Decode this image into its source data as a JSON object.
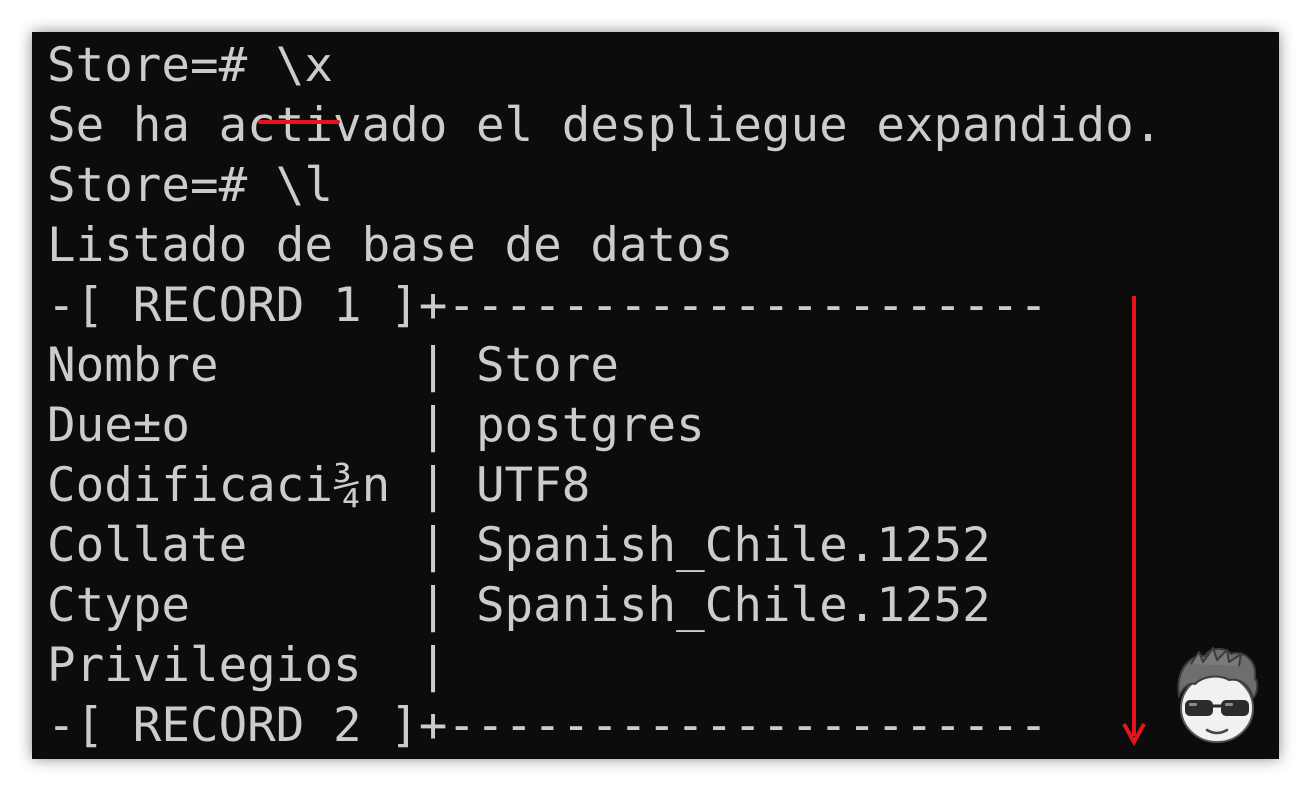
{
  "terminal": {
    "lines": [
      "Store=# \\x",
      "Se ha activado el despliegue expandido.",
      "Store=# \\l",
      "Listado de base de datos",
      "-[ RECORD 1 ]+---------------------",
      "Nombre       | Store",
      "Due±o        | postgres",
      "Codificaci¾n | UTF8",
      "Collate      | Spanish_Chile.1252",
      "Ctype        | Spanish_Chile.1252",
      "Privilegios  |",
      "-[ RECORD 2 ]+---------------------"
    ]
  },
  "annotations": {
    "underline_color": "#e8141b",
    "arrow_color": "#e8141b",
    "arrow_icon": "down-arrow-icon",
    "avatar_icon": "avatar-with-sunglasses-icon"
  },
  "colors": {
    "terminal_bg": "#0c0c0c",
    "terminal_text": "#cccccc"
  }
}
